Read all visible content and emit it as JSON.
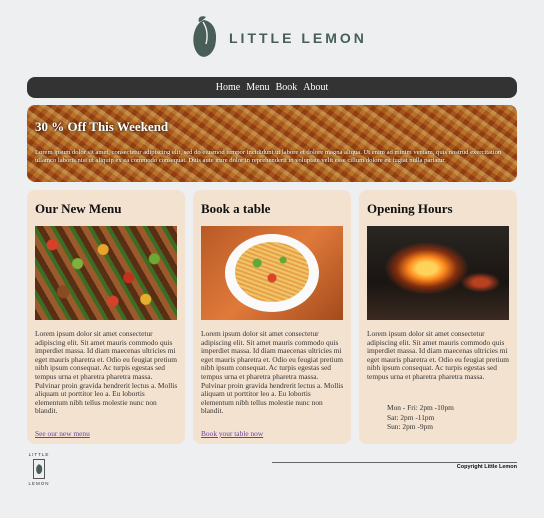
{
  "brand": {
    "name": "LITTLE LEMON",
    "icon": "lemon-logo-icon",
    "color": "#495e57"
  },
  "nav": {
    "items": [
      "Home",
      "Menu",
      "Book",
      "About"
    ]
  },
  "hero": {
    "title": "30 % Off This Weekend",
    "text": "Lorem ipsum dolor sit amet, consectetur adipiscing elit, sed do eiusmod tempor incididunt ut labore et dolore magna aliqua. Ut enim ad minim veniam, quis nostrud exercitation ullamco laboris nisi ut aliquip ex ea commodo consequat. Duis aute irure dolor in reprehenderit in voluptate velit esse cillum dolore eu fugiat nulla pariatur."
  },
  "cards": [
    {
      "title": "Our New Menu",
      "image": "kebab-image",
      "text": "Lorem ipsum dolor sit amet consectetur adipiscing elit. Sit amet mauris commodo quis imperdiet massa. Id diam maecenas ultricies mi eget mauris pharetra et. Odio eu feugiat pretium nibh ipsum consequat. Ac turpis egestas sed tempus urna et pharetra pharetra massa. Pulvinar proin gravida hendrerit lectus a. Mollis aliquam ut porttitor leo a. Eu lobortis elementum nibh tellus molestie nunc non blandit.",
      "link": "See our new menu"
    },
    {
      "title": "Book a table",
      "image": "noodles-image",
      "text": "Lorem ipsum dolor sit amet consectetur adipiscing elit. Sit amet mauris commodo quis imperdiet massa. Id diam maecenas ultricies mi eget mauris pharetra et. Odio eu feugiat pretium nibh ipsum consequat. Ac turpis egestas sed tempus urna et pharetra pharetra massa. Pulvinar proin gravida hendrerit lectus a. Mollis aliquam ut porttitor leo a. Eu lobortis elementum nibh tellus molestie nunc non blandit.",
      "link": "Book your table now"
    },
    {
      "title": "Opening Hours",
      "image": "kitchen-image",
      "text": "Lorem ipsum dolor sit amet consectetur adipiscing elit. Sit amet mauris commodo quis imperdiet massa. Id diam maecenas ultricies mi eget mauris pharetra et. Odio eu feugiat pretium nibh ipsum consequat. Ac turpis egestas sed tempus urna et pharetra pharetra massa.",
      "hours": [
        "Mon - Fri: 2pm -10pm",
        "Sat: 2pm -11pm",
        "Sun: 2pm -9pm"
      ]
    }
  ],
  "footer": {
    "logo_top": "LITTLE",
    "logo_bottom": "LEMON",
    "copyright": "Copyright Little Lemon"
  },
  "colors": {
    "card_bg": "#f3e2d0",
    "nav_bg": "#333333",
    "page_bg": "#edeff0",
    "link": "#6b3fa0"
  }
}
